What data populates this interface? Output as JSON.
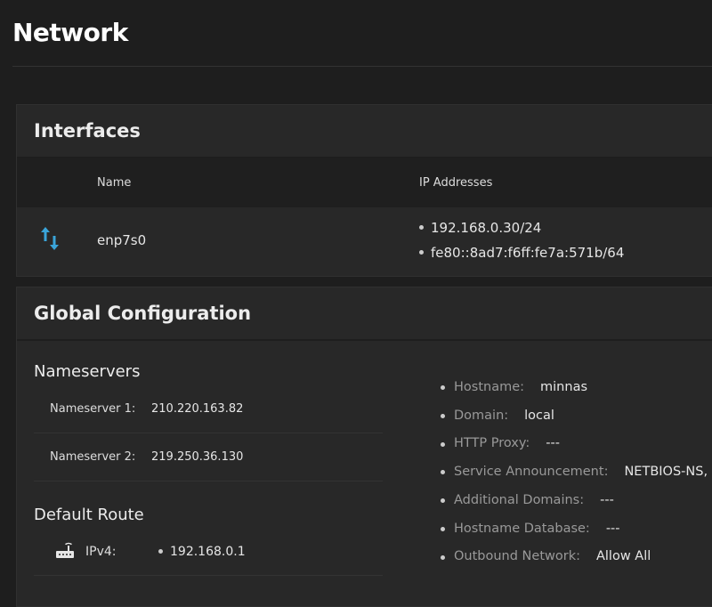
{
  "page_title": "Network",
  "interfaces": {
    "title": "Interfaces",
    "columns": [
      "Name",
      "IP Addresses"
    ],
    "rows": [
      {
        "icon": "arrows-up-down-icon",
        "name": "enp7s0",
        "ips": [
          "192.168.0.30/24",
          "fe80::8ad7:f6ff:fe7a:571b/64"
        ]
      }
    ]
  },
  "global": {
    "title": "Global Configuration",
    "nameservers_title": "Nameservers",
    "nameservers": [
      {
        "label": "Nameserver 1:",
        "value": "210.220.163.82"
      },
      {
        "label": "Nameserver 2:",
        "value": "219.250.36.130"
      }
    ],
    "default_route_title": "Default Route",
    "route": {
      "icon": "router-icon",
      "label": "IPv4:",
      "value": "192.168.0.1"
    },
    "settings": [
      {
        "label": "Hostname:",
        "value": "minnas"
      },
      {
        "label": "Domain:",
        "value": "local"
      },
      {
        "label": "HTTP Proxy:",
        "value": "---"
      },
      {
        "label": "Service Announcement:",
        "value": "NETBIOS-NS,"
      },
      {
        "label": "Additional Domains:",
        "value": "---"
      },
      {
        "label": "Hostname Database:",
        "value": "---"
      },
      {
        "label": "Outbound Network:",
        "value": "Allow All"
      }
    ]
  },
  "colors": {
    "accent": "#3aa4d9"
  }
}
